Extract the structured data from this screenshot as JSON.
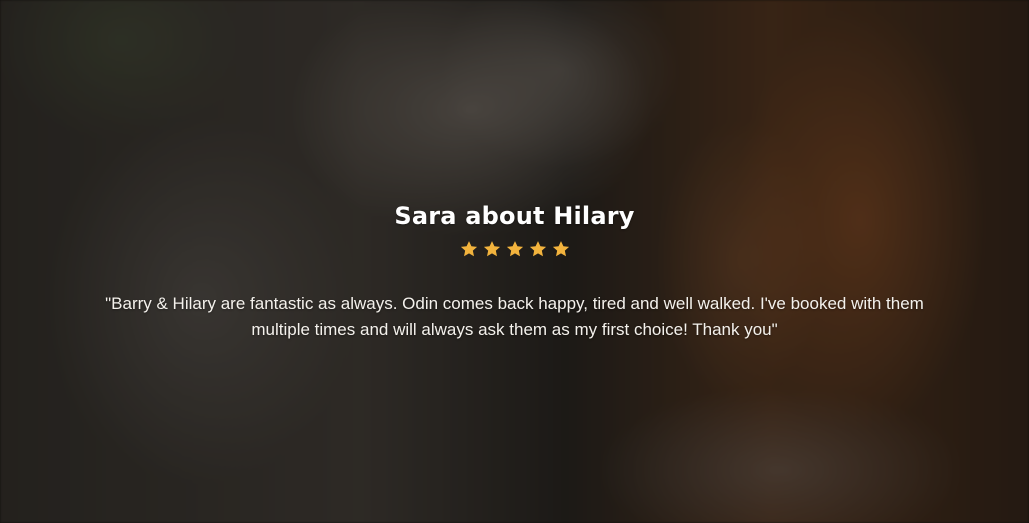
{
  "testimonial": {
    "title": "Sara about Hilary",
    "rating": 5,
    "rating_max": 5,
    "star_color": "#F2B33D",
    "quote": "\"Barry & Hilary are fantastic as always. Odin comes back happy, tired and well walked. I've booked with them multiple times and will always ask them as my first choice! Thank you\""
  },
  "background": {
    "icon": "dog-and-person-photo"
  }
}
